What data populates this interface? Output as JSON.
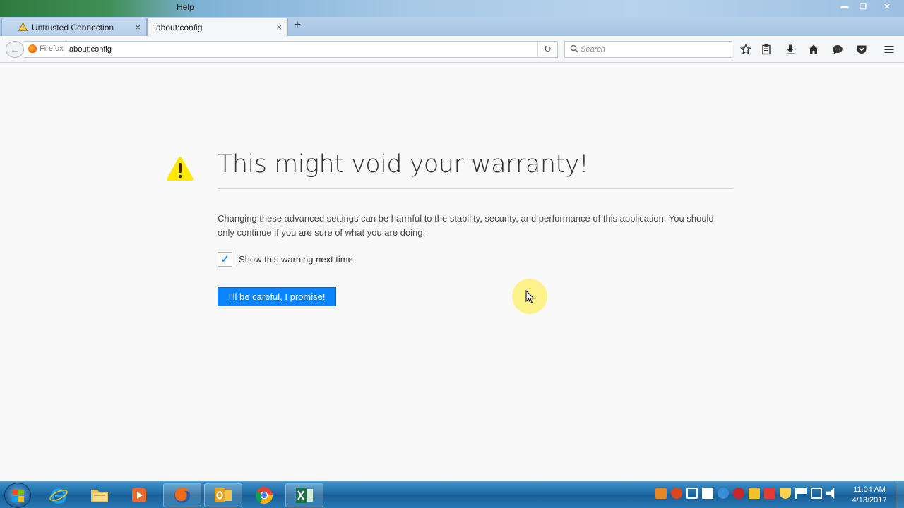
{
  "window": {
    "menu_help": "Help",
    "minimize_glyph": "▬",
    "maximize_glyph": "❐",
    "close_glyph": "✕"
  },
  "tabs": [
    {
      "label": "Untrusted Connection",
      "icon": "warning-icon",
      "active": false,
      "close": "×"
    },
    {
      "label": "about:config",
      "active": true,
      "close": "×"
    }
  ],
  "new_tab_glyph": "+",
  "navbar": {
    "back_glyph": "←",
    "identity_label": "Firefox",
    "url": "about:config",
    "reload_glyph": "↻",
    "search_placeholder": "Search",
    "toolbar_icons": [
      "bookmark-star-icon",
      "reading-list-icon",
      "downloads-icon",
      "home-icon",
      "chat-icon",
      "pocket-icon",
      "menu-icon"
    ]
  },
  "page": {
    "heading": "This might void your warranty!",
    "description": "Changing these advanced settings can be harmful to the stability, security, and performance of this application. You should only continue if you are sure of what you are doing.",
    "checkbox_label": "Show this warning next time",
    "checkbox_checked": true,
    "checkbox_glyph": "✓",
    "button_label": "I'll be careful, I promise!",
    "accent_color": "#0a84ff",
    "warning_color": "#ffe900"
  },
  "taskbar": {
    "apps": [
      "internet-explorer-icon",
      "file-explorer-icon",
      "media-player-icon",
      "firefox-icon",
      "outlook-icon",
      "chrome-icon",
      "excel-icon"
    ],
    "clock_time": "11:04 AM",
    "clock_date": "4/13/2017"
  }
}
